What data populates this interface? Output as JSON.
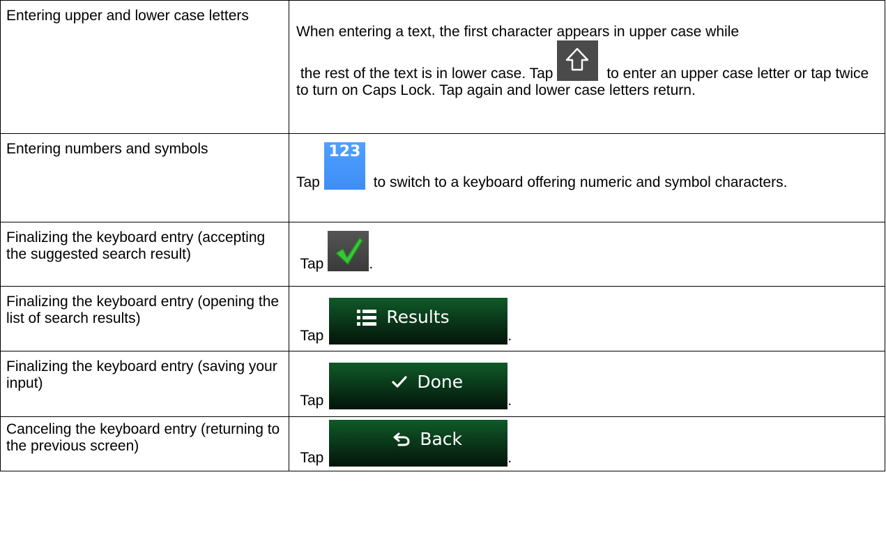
{
  "rows": [
    {
      "label": "Entering upper and lower case letters",
      "desc_before": "When entering a text, the first character appears in upper case while",
      "desc_mid": "the rest of the text is in lower case. Tap",
      "desc_after": " to enter an upper case letter or tap twice to turn on Caps Lock. Tap again and lower case letters return.",
      "icon": "shift-arrow-icon"
    },
    {
      "label": "Entering numbers and symbols",
      "tap": "Tap",
      "key_label": "123",
      "desc_after": "to switch to a keyboard offering numeric and symbol characters."
    },
    {
      "label": "Finalizing the keyboard entry (accepting the suggested search result)",
      "tap": "Tap",
      "icon": "green-checkmark-icon",
      "end": "."
    },
    {
      "label": "Finalizing the keyboard entry (opening the list of search results)",
      "tap": "Tap",
      "button_label": "Results",
      "icon": "list-icon",
      "end": "."
    },
    {
      "label": "Finalizing the keyboard entry (saving your input)",
      "tap": "Tap",
      "button_label": "Done",
      "icon": "check-icon",
      "end": "."
    },
    {
      "label": "Canceling the keyboard entry (returning to the previous screen)",
      "tap": "Tap",
      "button_label": "Back",
      "icon": "back-arrow-icon",
      "end": "."
    }
  ],
  "colors": {
    "key_dark": "#4a4a4a",
    "key_blue": "#3e8df5",
    "button_green": "#0f5a28",
    "check_green": "#3cc33c"
  }
}
